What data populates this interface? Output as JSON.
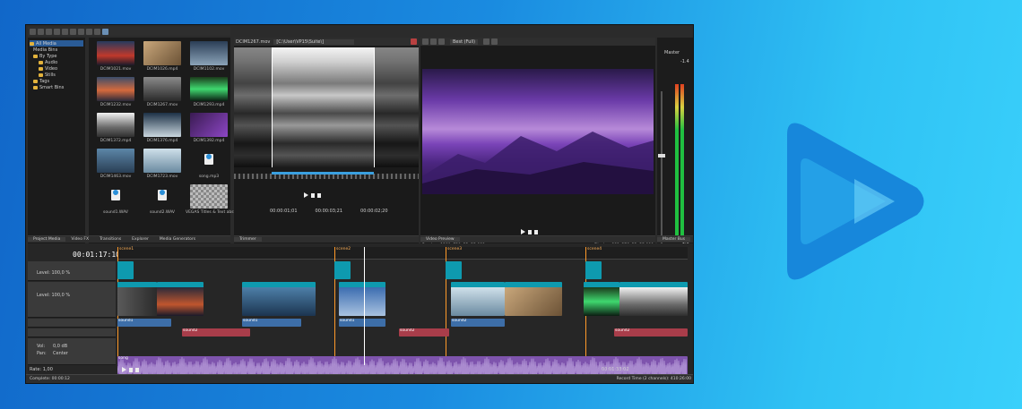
{
  "explorer": {
    "tree": [
      "All Media",
      "Media Bins",
      "By Type",
      "Audio",
      "Video",
      "Stills",
      "Tags",
      "Smart Bins"
    ]
  },
  "media": [
    {
      "label": "DCIM1021.mov",
      "color": "linear-gradient(#263a5e,#c0392b 60%,#1a1a2a)"
    },
    {
      "label": "DCIM1026.mp4",
      "color": "linear-gradient(135deg,#c9a77b,#6b5236)"
    },
    {
      "label": "DCIM1102.mov",
      "color": "linear-gradient(#2b3e56,#8ba3b8)"
    },
    {
      "label": "DCIM1232.mov",
      "color": "linear-gradient(#3b4d6a,#d56a3d 55%,#2a2a3a)"
    },
    {
      "label": "DCIM1267.mov",
      "color": "linear-gradient(#8a8a8a,#2a2a2a)"
    },
    {
      "label": "DCIM1293.mp4",
      "color": "linear-gradient(#1b3a1b,#3fd86f 50%,#0b1d12)"
    },
    {
      "label": "DCIM1372.mp4",
      "color": "linear-gradient(#f2f2f2,#6b6b6b 60%,#2f2f2f)"
    },
    {
      "label": "DCIM1376.mp4",
      "color": "linear-gradient(#1d3146,#c9d6de)"
    },
    {
      "label": "DCIM1392.mp4",
      "color": "linear-gradient(135deg,#3a1b52,#8c46c4)"
    },
    {
      "label": "DCIM1463.mov",
      "color": "linear-gradient(#5c86a8,#2a3f55)"
    },
    {
      "label": "DCIM1723.mov",
      "color": "linear-gradient(#cfe0ea,#6a8aa0)"
    },
    {
      "label": "song.mp3",
      "color": "audio"
    },
    {
      "label": "sound1.WAV",
      "color": "audio"
    },
    {
      "label": "sound2.WAV",
      "color": "audio"
    },
    {
      "label": "VEGAS Titles & Text abstract",
      "color": "checker"
    }
  ],
  "tabs": {
    "left": [
      "Project Media",
      "Video FX",
      "Transitions",
      "Explorer",
      "Media Generators"
    ],
    "trimmer": "Trimmer",
    "preview": "Video Preview",
    "master": "Master Bus"
  },
  "trimmer": {
    "file": "DCIM1267.mov",
    "path": "[C:\\User\\VP15\\Suite\\]",
    "time_in": "00:00:01;01",
    "time_out": "00:00:03;21",
    "time_len": "00:00:02;20"
  },
  "preview": {
    "quality": "Best (Full)",
    "project": "1280x720x32, 25,000p",
    "preview_label": "Preview: 1280x720x32, 25,000p",
    "frame": "1,925",
    "display": "Display: 668x376x32, 25,000",
    "project_label": "Project:",
    "frame_label": "Frame:"
  },
  "master": {
    "label": "Master",
    "db_top": "-1.4",
    "db_bot": "-1.5"
  },
  "timeline": {
    "timecode": "00:01:17:10",
    "tracks": [
      {
        "level": "Level: 100,0 %"
      },
      {
        "level": "Level: 100,0 %"
      }
    ],
    "audio": {
      "vol": "Vol:",
      "vol_val": "0,0 dB",
      "pan": "Pan:",
      "pan_val": "Center"
    },
    "rate": "Rate: 1,00",
    "markers": [
      "scene1",
      "scene2",
      "scene3",
      "scene4"
    ],
    "clips_video": [
      "DCIM1267",
      "DCIM1039",
      "DCIM1463",
      "DCIM1392",
      "DCIM1723",
      "DCIM1026",
      "DCIM1021",
      "DCIM1372"
    ],
    "clips_audio": [
      "sound1",
      "sound2",
      "sound1",
      "sound1",
      "sound2",
      "sound2",
      "sound2"
    ],
    "song": "song",
    "end_time": "00:01:33:02"
  },
  "status": {
    "left": "Complete: 00:00:12",
    "right": "Record Time (2 channels): 410:26:00"
  },
  "colors": {
    "accent": "#1d9ad6",
    "audio_clip": "#7e54ad",
    "video_clip": "#0e9aaf",
    "marker": "#ff9a2a"
  }
}
